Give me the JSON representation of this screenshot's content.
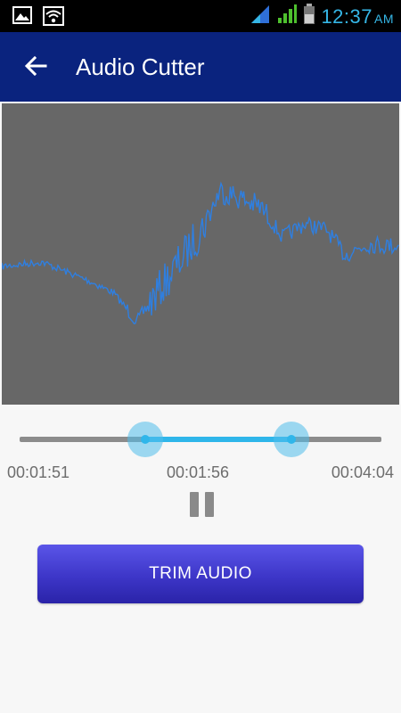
{
  "status_bar": {
    "time": "12:37",
    "ampm": "AM",
    "icons": [
      "image-icon",
      "wifi-icon",
      "signal-icon",
      "signal-icon",
      "battery-icon"
    ],
    "clock_color": "#35b6e6"
  },
  "app_bar": {
    "title": "Audio Cutter",
    "background": "#0a237e",
    "back_icon": "arrow-left-icon"
  },
  "waveform": {
    "background": "#676767",
    "line_color": "#2f7fe0"
  },
  "trim_range": {
    "start_time": "00:01:51",
    "current_time": "00:01:56",
    "end_time": "00:04:04",
    "start_fraction": 0.347,
    "end_fraction": 0.752,
    "accent": "#2fb6ea"
  },
  "playback": {
    "control_icon": "pause-icon"
  },
  "actions": {
    "trim_label": "TRIM AUDIO"
  }
}
